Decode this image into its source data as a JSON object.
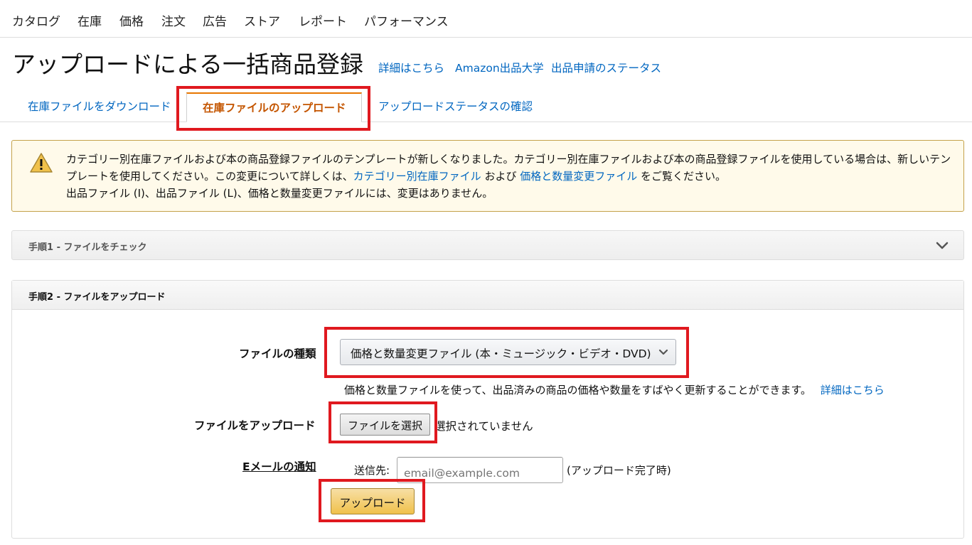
{
  "nav": {
    "items": [
      "カタログ",
      "在庫",
      "価格",
      "注文",
      "広告",
      "ストア",
      "レポート",
      "パフォーマンス"
    ]
  },
  "page": {
    "title": "アップロードによる一括商品登録",
    "links": [
      "詳細はこちら",
      "Amazon出品大学",
      "出品申請のステータス"
    ]
  },
  "tabs": {
    "download": "在庫ファイルをダウンロード",
    "upload": "在庫ファイルのアップロード",
    "status": "アップロードステータスの確認"
  },
  "alert": {
    "icon": "warning-icon",
    "line1_prefix": "カテゴリー別在庫ファイルおよび本の商品登録ファイルのテンプレートが新しくなりました。カテゴリー別在庫ファイルおよび本の商品登録ファイルを使用している場合は、新しいテンプレートを使用してください。この変更について詳しくは、",
    "link1": "カテゴリー別在庫ファイル",
    "and": " および ",
    "link2": "価格と数量変更ファイル",
    "line1_suffix": " をご覧ください。",
    "line2": "出品ファイル (I)、出品ファイル (L)、価格と数量変更ファイルには、変更はありません。"
  },
  "step1": {
    "label": "手順1 - ファイルをチェック",
    "icon": "chevron-down-icon"
  },
  "step2": {
    "label": "手順2 - ファイルをアップロード",
    "file_type_label": "ファイルの種類",
    "file_type_value": "価格と数量変更ファイル (本・ミュージック・ビデオ・DVD)",
    "help_text": "価格と数量ファイルを使って、出品済みの商品の価格や数量をすばやく更新することができます。",
    "help_link": "詳細はこちら",
    "upload_label": "ファイルをアップロード",
    "choose_file_button": "ファイルを選択",
    "file_status": "選択されていません",
    "email_label": "Eメールの通知",
    "send_to": "送信先:",
    "email_placeholder": "email@example.com",
    "email_suffix": "(アップロード完了時)",
    "upload_button": "アップロード"
  },
  "colors": {
    "link": "#0066c0",
    "active_tab": "#c45500",
    "highlight": "#e0191f",
    "primary_button": "#f0c14b",
    "alert_bg": "#fffaea"
  }
}
